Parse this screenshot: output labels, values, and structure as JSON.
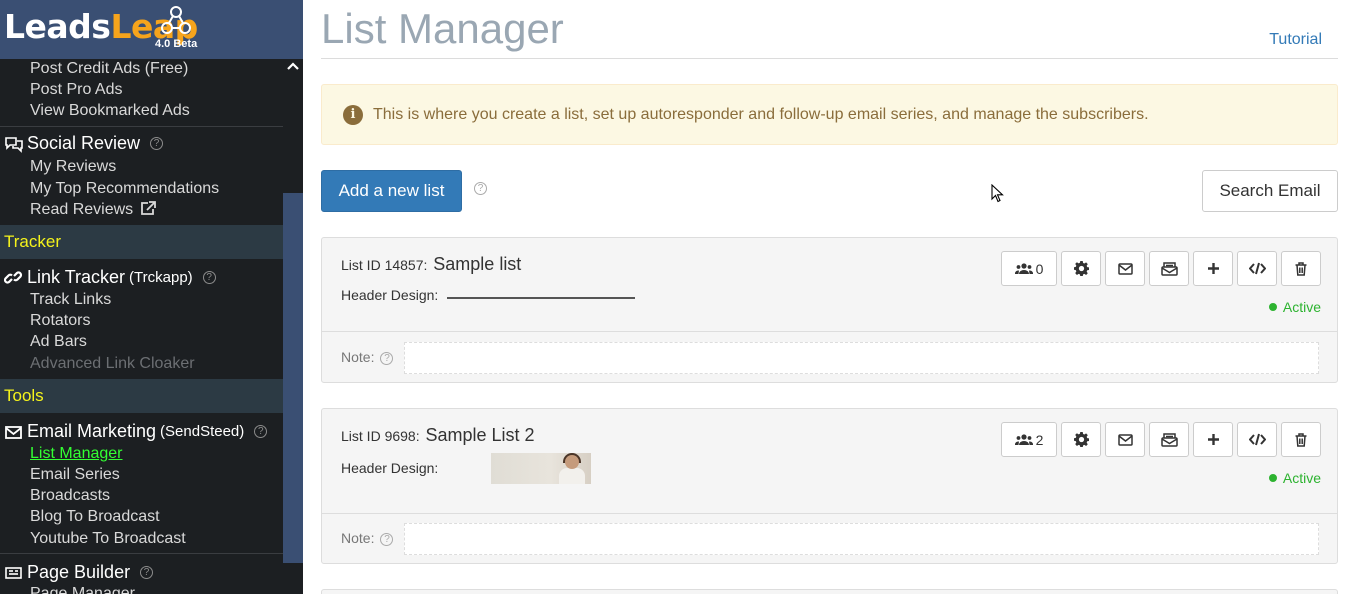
{
  "logo": {
    "part1": "Leads",
    "part2": "Leap",
    "version": "4.0 Beta"
  },
  "sidebar": {
    "top_links": [
      "Post Credit Ads (Free)",
      "Post Pro Ads",
      "View Bookmarked Ads"
    ],
    "social_review": {
      "title": "Social Review",
      "links": [
        "My Reviews",
        "My Top Recommendations",
        "Read Reviews"
      ]
    },
    "tracker_section": "Tracker",
    "link_tracker": {
      "title": "Link Tracker",
      "sub": "(Trckapp)",
      "links": [
        "Track Links",
        "Rotators",
        "Ad Bars",
        "Advanced Link Cloaker"
      ]
    },
    "tools_section": "Tools",
    "email_marketing": {
      "title": "Email Marketing",
      "sub": "(SendSteed)",
      "links": [
        "List Manager",
        "Email Series",
        "Broadcasts",
        "Blog To Broadcast",
        "Youtube To Broadcast"
      ]
    },
    "page_builder": {
      "title": "Page Builder",
      "links": [
        "Page Manager"
      ]
    }
  },
  "main": {
    "title": "List Manager",
    "tutorial": "Tutorial",
    "info": "This is where you create a list, set up autoresponder and follow-up email series, and manage the subscribers.",
    "add_list": "Add a new list",
    "search_email": "Search Email"
  },
  "lists": [
    {
      "id_label": "List ID 14857:",
      "name": "Sample list",
      "header_label": "Header Design:",
      "subscribers": "0",
      "status": "Active",
      "note_label": "Note:"
    },
    {
      "id_label": "List ID 9698:",
      "name": "Sample List 2",
      "header_label": "Header Design:",
      "subscribers": "2",
      "status": "Active",
      "note_label": "Note:"
    }
  ],
  "colors": {
    "sidebar_bg": "#1c1f22",
    "logo_bg": "#3a4f73",
    "primary": "#337ab7",
    "active_green": "#2db330",
    "section_yellow": "#f5f31b"
  },
  "icons": [
    "help-icon",
    "external-link-icon",
    "users-icon",
    "gear-icon",
    "envelope-icon",
    "envelope-open-icon",
    "plus-icon",
    "code-icon",
    "trash-icon",
    "info-icon"
  ]
}
